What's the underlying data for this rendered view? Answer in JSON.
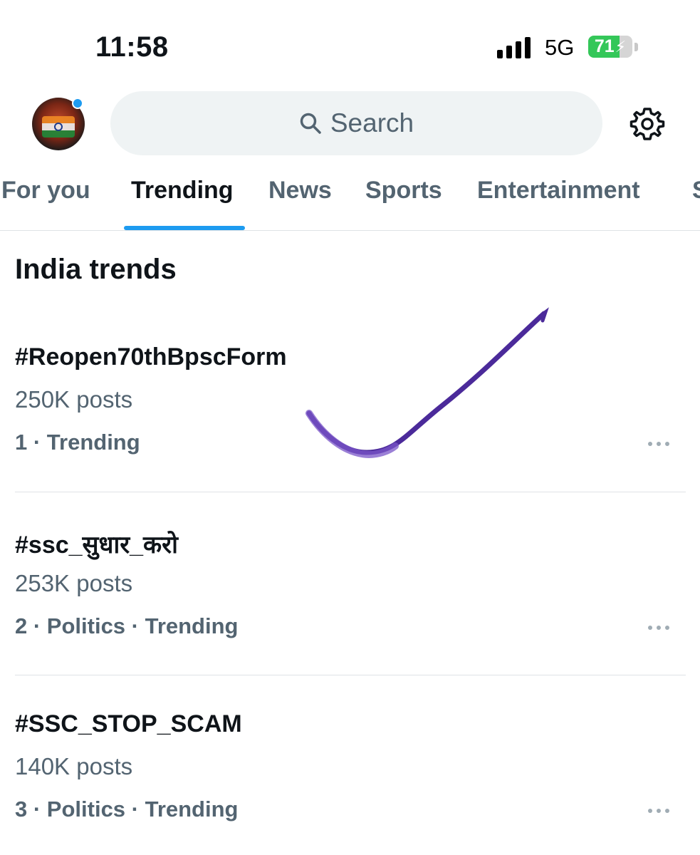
{
  "status_bar": {
    "time": "11:58",
    "network": "5G",
    "battery_percent": 71,
    "battery_label": "71",
    "signal_bars": 4
  },
  "header": {
    "search_placeholder": "Search",
    "avatar_icon": "profile-avatar",
    "settings_icon": "gear-icon"
  },
  "tabs": [
    {
      "label": "For you",
      "active": false
    },
    {
      "label": "Trending",
      "active": true
    },
    {
      "label": "News",
      "active": false
    },
    {
      "label": "Sports",
      "active": false
    },
    {
      "label": "Entertainment",
      "active": false
    },
    {
      "label": "S",
      "active": false
    }
  ],
  "section_title": "India trends",
  "trends": [
    {
      "name": "#Reopen70thBpscForm",
      "posts": "250K posts",
      "meta": "1 · Trending"
    },
    {
      "name": "#ssc_सुधार_करो",
      "posts": "253K posts",
      "meta": "2 · Politics · Trending"
    },
    {
      "name": "#SSC_STOP_SCAM",
      "posts": "140K posts",
      "meta": "3 · Politics · Trending"
    }
  ],
  "colors": {
    "accent": "#1d9bf0",
    "text_primary": "#0f1419",
    "text_secondary": "#536471",
    "battery_green": "#34c759",
    "annotation_check": "#4b2a9a"
  }
}
